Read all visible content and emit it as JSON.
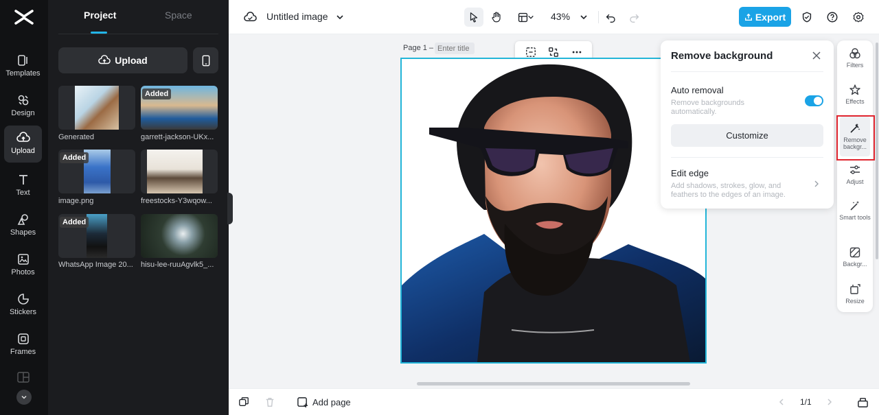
{
  "rail": {
    "items": [
      {
        "label": "Templates",
        "icon": "templates-icon"
      },
      {
        "label": "Design",
        "icon": "design-icon"
      },
      {
        "label": "Upload",
        "icon": "upload-cloud-icon"
      },
      {
        "label": "Text",
        "icon": "text-icon"
      },
      {
        "label": "Shapes",
        "icon": "shapes-icon"
      },
      {
        "label": "Photos",
        "icon": "photos-icon"
      },
      {
        "label": "Stickers",
        "icon": "stickers-icon"
      },
      {
        "label": "Frames",
        "icon": "frames-icon"
      }
    ],
    "active_item": "Upload"
  },
  "panel": {
    "tabs": [
      {
        "label": "Project"
      },
      {
        "label": "Space"
      }
    ],
    "upload_label": "Upload",
    "added_badge": "Added",
    "thumbnails": [
      {
        "caption": "Generated",
        "added": false
      },
      {
        "caption": "garrett-jackson-UKx...",
        "added": true
      },
      {
        "caption": "image.png",
        "added": true
      },
      {
        "caption": "freestocks-Y3wqow...",
        "added": false
      },
      {
        "caption": "WhatsApp Image 20...",
        "added": true
      },
      {
        "caption": "hisu-lee-ruuAgvlk5_...",
        "added": false
      }
    ]
  },
  "topbar": {
    "doc_title": "Untitled image",
    "zoom": "43%",
    "export_label": "Export"
  },
  "canvas": {
    "page_label": "Page 1 –",
    "title_placeholder": "Enter title"
  },
  "remove_bg": {
    "title": "Remove background",
    "auto_removal_label": "Auto removal",
    "auto_removal_desc": "Remove backgrounds automatically.",
    "auto_removal_on": true,
    "customize_label": "Customize",
    "edit_edge_label": "Edit edge",
    "edit_edge_desc": "Add shadows, strokes, glow, and feathers to the edges of an image."
  },
  "right_tools": [
    {
      "label": "Filters",
      "icon": "filters-icon"
    },
    {
      "label": "Effects",
      "icon": "effects-icon"
    },
    {
      "label": "Remove backgr...",
      "icon": "remove-background-icon"
    },
    {
      "label": "Adjust",
      "icon": "adjust-icon"
    },
    {
      "label": "Smart tools",
      "icon": "magic-wand-icon"
    },
    {
      "label": "Backgr...",
      "icon": "background-icon"
    },
    {
      "label": "Resize",
      "icon": "resize-icon"
    }
  ],
  "bottombar": {
    "add_page_label": "Add page",
    "pager": "1/1"
  },
  "colors": {
    "accent": "#1aa3e6",
    "selection": "#22b5d8",
    "highlight": "#e0242e",
    "rail_bg": "#111214",
    "panel_bg": "#1b1c1f"
  }
}
